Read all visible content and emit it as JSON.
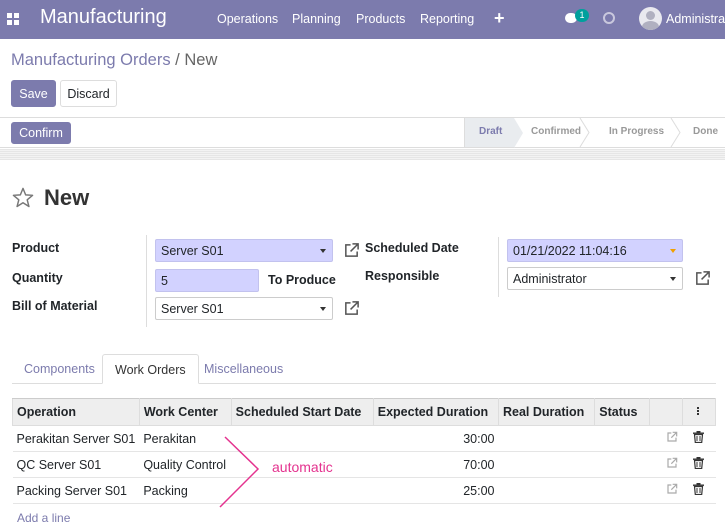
{
  "navbar": {
    "brand": "Manufacturing",
    "menu": [
      "Operations",
      "Planning",
      "Products",
      "Reporting"
    ],
    "chat_count": "1",
    "user": "Administrator"
  },
  "breadcrumb": {
    "parent": "Manufacturing Orders",
    "separator": "/",
    "current": "New"
  },
  "buttons": {
    "save": "Save",
    "discard": "Discard",
    "confirm": "Confirm"
  },
  "statusbar": {
    "stages": [
      "Draft",
      "Confirmed",
      "In Progress",
      "Done"
    ],
    "active": "Draft"
  },
  "form": {
    "title": "New",
    "product_label": "Product",
    "product_value": "Server S01",
    "quantity_label": "Quantity",
    "quantity_value": "5",
    "to_produce_label": "To Produce",
    "bom_label": "Bill of Material",
    "bom_value": "Server S01",
    "scheduled_date_label": "Scheduled Date",
    "scheduled_date_value": "01/21/2022 11:04:16",
    "responsible_label": "Responsible",
    "responsible_value": "Administrator"
  },
  "tabs": [
    "Components",
    "Work Orders",
    "Miscellaneous"
  ],
  "active_tab": "Work Orders",
  "work_orders": {
    "columns": [
      "Operation",
      "Work Center",
      "Scheduled Start Date",
      "Expected Duration",
      "Real Duration",
      "Status"
    ],
    "rows": [
      {
        "operation": "Perakitan Server S01",
        "work_center": "Perakitan",
        "expected_duration": "30:00"
      },
      {
        "operation": "QC Server S01",
        "work_center": "Quality Control",
        "expected_duration": "70:00"
      },
      {
        "operation": "Packing Server S01",
        "work_center": "Packing",
        "expected_duration": "25:00"
      }
    ],
    "add_line": "Add a line"
  },
  "annotation": {
    "text": "automatic",
    "color": "#e4338f"
  },
  "colors": {
    "brand": "#7c7bad",
    "required_field": "#d2d2ff"
  }
}
